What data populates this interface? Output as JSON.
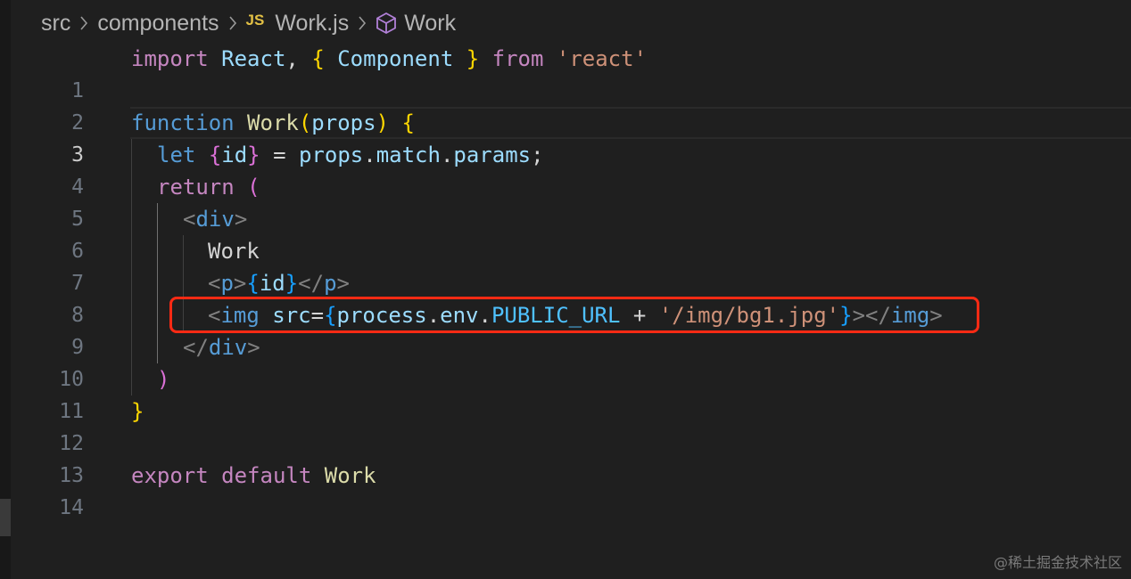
{
  "breadcrumb": {
    "folder1": "src",
    "folder2": "components",
    "file_badge": "JS",
    "file": "Work.js",
    "symbol": "Work",
    "icons": [
      "chevron-right-icon",
      "js-file-icon",
      "cube-symbol-icon"
    ]
  },
  "editor": {
    "active_line": 3,
    "lines": [
      {
        "n": "1"
      },
      {
        "n": "2"
      },
      {
        "n": "3"
      },
      {
        "n": "4"
      },
      {
        "n": "5"
      },
      {
        "n": "6"
      },
      {
        "n": "7"
      },
      {
        "n": "8"
      },
      {
        "n": "9"
      },
      {
        "n": "10"
      },
      {
        "n": "11"
      },
      {
        "n": "12"
      },
      {
        "n": "13"
      },
      {
        "n": "14"
      }
    ],
    "tokens": {
      "l1": [
        "import",
        " ",
        "React",
        ", ",
        "{",
        " ",
        "Component",
        " ",
        "}",
        " ",
        "from",
        " ",
        "'react'"
      ],
      "l3": [
        "function",
        " ",
        "Work",
        "(",
        "props",
        ")",
        " ",
        "{"
      ],
      "l4": [
        "let",
        " ",
        "{",
        "id",
        "}",
        " = ",
        "props",
        ".",
        "match",
        ".",
        "params",
        ";"
      ],
      "l5": [
        "return",
        " ",
        "("
      ],
      "l6": [
        "<",
        "div",
        ">"
      ],
      "l7": [
        "Work"
      ],
      "l8": [
        "<",
        "p",
        ">",
        "{",
        "id",
        "}",
        "</",
        "p",
        ">"
      ],
      "l9": [
        "<",
        "img",
        " ",
        "src",
        "=",
        "{",
        "process",
        ".",
        "env",
        ".",
        "PUBLIC_URL",
        " + ",
        "'/img/bg1.jpg'",
        "}",
        "></",
        "img",
        ">"
      ],
      "l10": [
        "</",
        "div",
        ">"
      ],
      "l11": [
        ")"
      ],
      "l12": [
        "}"
      ],
      "l14": [
        "export",
        " ",
        "default",
        " ",
        "Work"
      ]
    }
  },
  "colors": {
    "background": "#1f1f1f",
    "highlight_box": "#ff2a14",
    "keyword_purple": "#c586c0",
    "keyword_blue": "#569cd6",
    "variable": "#9cdcfe",
    "function": "#dcdcaa",
    "string": "#ce9178"
  },
  "watermark": "@稀土掘金技术社区"
}
